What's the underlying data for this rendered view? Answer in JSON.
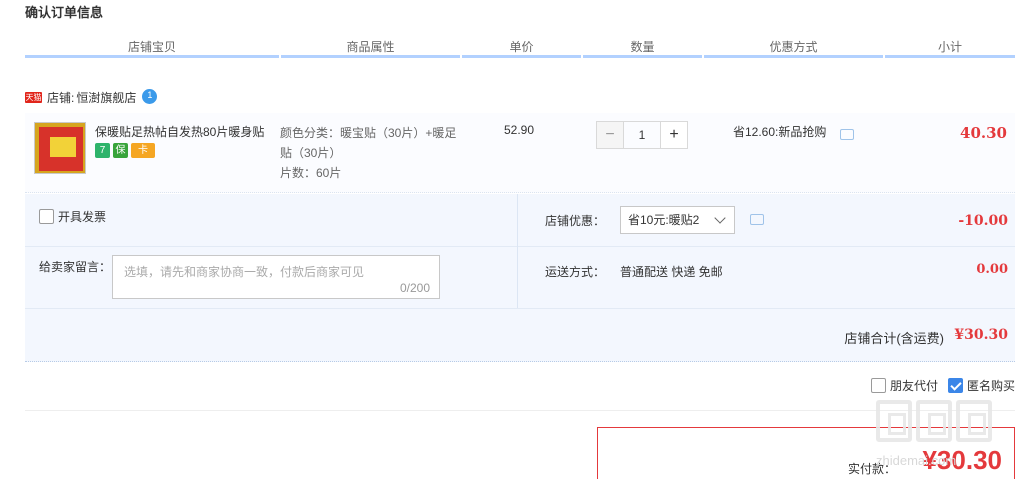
{
  "page": {
    "title": "确认订单信息"
  },
  "columns": [
    "店铺宝贝",
    "商品属性",
    "单价",
    "数量",
    "优惠方式",
    "小计"
  ],
  "shop": {
    "badge": "天猫",
    "label": "店铺:",
    "name": "恒澍旗舰店"
  },
  "item": {
    "title": "保暖贴足热帖自发热80片暖身贴",
    "service_icons": [
      "7",
      "保",
      "卡"
    ],
    "props": [
      "颜色分类：暖宝贴（30片）+暖足贴（30片）",
      "片数：60片"
    ],
    "unit_price": "52.90",
    "quantity": "1",
    "qty_minus": "−",
    "qty_plus": "+",
    "promo": "省12.60:新品抢购",
    "subtotal": "40.30"
  },
  "extras": {
    "invoice_label": "开具发票",
    "message_label": "给卖家留言：",
    "message_placeholder": "选填，请先和商家协商一致，付款后商家可见",
    "message_count": "0/200",
    "shop_discount_label": "店铺优惠：",
    "shop_discount_selected": "省10元:暖贴2",
    "shop_discount_amount": "-10.00",
    "shipping_label": "运送方式：",
    "shipping_value": "普通配送 快递 免邮",
    "shipping_amount": "0.00",
    "shop_total_label": "店铺合计(含运费)",
    "shop_total_value": "¥30.30"
  },
  "options": {
    "friend_pay_label": "朋友代付",
    "friend_pay_checked": false,
    "anonymous_label": "匿名购买",
    "anonymous_checked": true
  },
  "payment": {
    "label": "实付款：",
    "value": "¥30.30"
  },
  "watermark": {
    "domain": "zhidemai.com"
  },
  "colors": {
    "accent_red": "#e4393c",
    "header_line": "#b2d1ff",
    "panel_bg": "#f3f7fe",
    "check_blue": "#3b86e8"
  }
}
